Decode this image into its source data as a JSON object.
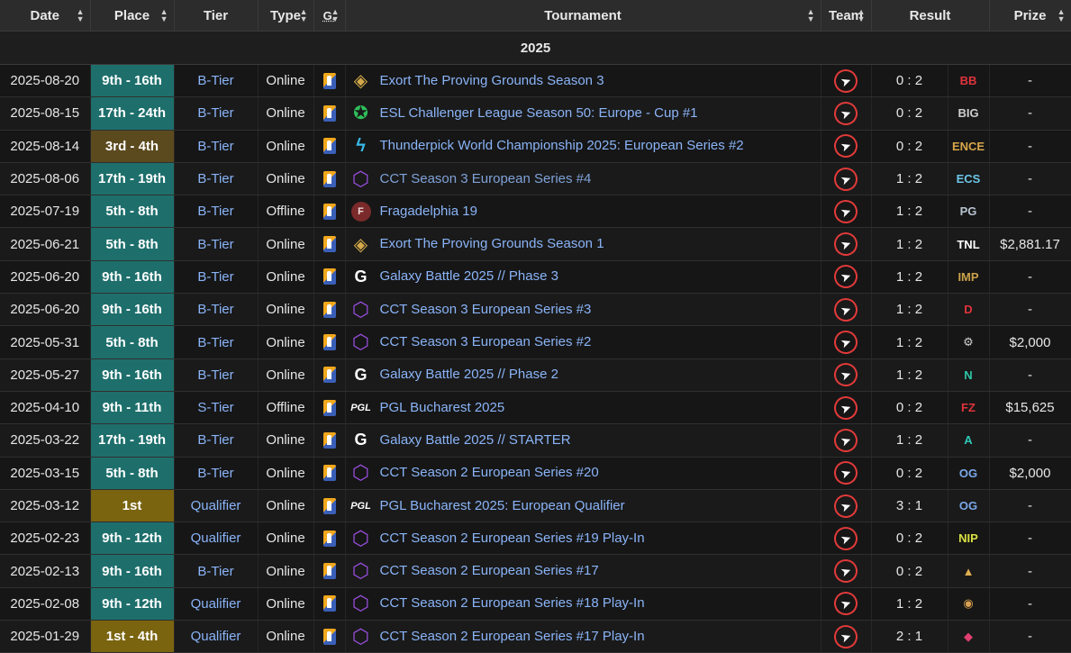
{
  "header": {
    "date": "Date",
    "place": "Place",
    "tier": "Tier",
    "type": "Type",
    "game": "G.",
    "tournament": "Tournament",
    "team": "Team",
    "result": "Result",
    "prize": "Prize"
  },
  "year": "2025",
  "rows": [
    {
      "date": "2025-08-20",
      "place": "9th - 16th",
      "placeStyle": "teal",
      "tier": "B-Tier",
      "type": "Online",
      "ticon": "exort",
      "tournament": "Exort The Proving Grounds Season 3",
      "score": "0 : 2",
      "opp": "BB",
      "oppColor": "#e0343c",
      "prize": "-"
    },
    {
      "date": "2025-08-15",
      "place": "17th - 24th",
      "placeStyle": "teal",
      "tier": "B-Tier",
      "type": "Online",
      "ticon": "esl",
      "tournament": "ESL Challenger League Season 50: Europe - Cup #1",
      "score": "0 : 2",
      "opp": "BIG",
      "oppColor": "#cfcfcf",
      "prize": "-"
    },
    {
      "date": "2025-08-14",
      "place": "3rd - 4th",
      "placeStyle": "brown",
      "tier": "B-Tier",
      "type": "Online",
      "ticon": "thunder",
      "tournament": "Thunderpick World Championship 2025: European Series #2",
      "score": "0 : 2",
      "opp": "ENCE",
      "oppColor": "#d8a64a",
      "prize": "-"
    },
    {
      "date": "2025-08-06",
      "place": "17th - 19th",
      "placeStyle": "teal",
      "tier": "B-Tier",
      "type": "Online",
      "ticon": "cct",
      "tournament": "CCT Season 3 European Series #4",
      "score": "1 : 2",
      "opp": "ECS",
      "oppColor": "#6cc6e8",
      "prize": "-",
      "dim": true
    },
    {
      "date": "2025-07-19",
      "place": "5th - 8th",
      "placeStyle": "teal",
      "tier": "B-Tier",
      "type": "Offline",
      "ticon": "frag",
      "tournament": "Fragadelphia 19",
      "score": "1 : 2",
      "opp": "PG",
      "oppColor": "#b8c4d0",
      "prize": "-"
    },
    {
      "date": "2025-06-21",
      "place": "5th - 8th",
      "placeStyle": "teal",
      "tier": "B-Tier",
      "type": "Online",
      "ticon": "exort",
      "tournament": "Exort The Proving Grounds Season 1",
      "score": "1 : 2",
      "opp": "TNL",
      "oppColor": "#ffffff",
      "prize": "$2,881.17"
    },
    {
      "date": "2025-06-20",
      "place": "9th - 16th",
      "placeStyle": "teal",
      "tier": "B-Tier",
      "type": "Online",
      "ticon": "galaxy",
      "tournament": "Galaxy Battle 2025 // Phase 3",
      "score": "1 : 2",
      "opp": "IMP",
      "oppColor": "#c9a24a",
      "prize": "-"
    },
    {
      "date": "2025-06-20",
      "place": "9th - 16th",
      "placeStyle": "teal",
      "tier": "B-Tier",
      "type": "Online",
      "ticon": "cct",
      "tournament": "CCT Season 3 European Series #3",
      "score": "1 : 2",
      "opp": "D",
      "oppColor": "#e0343c",
      "prize": "-"
    },
    {
      "date": "2025-05-31",
      "place": "5th - 8th",
      "placeStyle": "teal",
      "tier": "B-Tier",
      "type": "Online",
      "ticon": "cct",
      "tournament": "CCT Season 3 European Series #2",
      "score": "1 : 2",
      "opp": "⚙",
      "oppColor": "#cfcfcf",
      "prize": "$2,000"
    },
    {
      "date": "2025-05-27",
      "place": "9th - 16th",
      "placeStyle": "teal",
      "tier": "B-Tier",
      "type": "Online",
      "ticon": "galaxy",
      "tournament": "Galaxy Battle 2025 // Phase 2",
      "score": "1 : 2",
      "opp": "N",
      "oppColor": "#2fc8a8",
      "prize": "-"
    },
    {
      "date": "2025-04-10",
      "place": "9th - 11th",
      "placeStyle": "teal",
      "tier": "S-Tier",
      "type": "Offline",
      "ticon": "pgl",
      "tournament": "PGL Bucharest 2025",
      "score": "0 : 2",
      "opp": "FZ",
      "oppColor": "#e0343c",
      "prize": "$15,625"
    },
    {
      "date": "2025-03-22",
      "place": "17th - 19th",
      "placeStyle": "teal",
      "tier": "B-Tier",
      "type": "Online",
      "ticon": "galaxy",
      "tournament": "Galaxy Battle 2025 // STARTER",
      "score": "1 : 2",
      "opp": "A",
      "oppColor": "#2fc8b8",
      "prize": "-"
    },
    {
      "date": "2025-03-15",
      "place": "5th - 8th",
      "placeStyle": "teal",
      "tier": "B-Tier",
      "type": "Online",
      "ticon": "cct",
      "tournament": "CCT Season 2 European Series #20",
      "score": "0 : 2",
      "opp": "OG",
      "oppColor": "#7aa8e8",
      "prize": "$2,000"
    },
    {
      "date": "2025-03-12",
      "place": "1st",
      "placeStyle": "gold",
      "tier": "Qualifier",
      "type": "Online",
      "ticon": "pgl",
      "tournament": "PGL Bucharest 2025: European Qualifier",
      "score": "3 : 1",
      "opp": "OG",
      "oppColor": "#7aa8e8",
      "prize": "-"
    },
    {
      "date": "2025-02-23",
      "place": "9th - 12th",
      "placeStyle": "teal",
      "tier": "Qualifier",
      "type": "Online",
      "ticon": "cct",
      "tournament": "CCT Season 2 European Series #19 Play-In",
      "score": "0 : 2",
      "opp": "NIP",
      "oppColor": "#d8e040",
      "prize": "-"
    },
    {
      "date": "2025-02-13",
      "place": "9th - 16th",
      "placeStyle": "teal",
      "tier": "B-Tier",
      "type": "Online",
      "ticon": "cct",
      "tournament": "CCT Season 2 European Series #17",
      "score": "0 : 2",
      "opp": "▲",
      "oppColor": "#e0b050",
      "prize": "-"
    },
    {
      "date": "2025-02-08",
      "place": "9th - 12th",
      "placeStyle": "teal",
      "tier": "Qualifier",
      "type": "Online",
      "ticon": "cct",
      "tournament": "CCT Season 2 European Series #18 Play-In",
      "score": "1 : 2",
      "opp": "◉",
      "oppColor": "#d8a050",
      "prize": "-"
    },
    {
      "date": "2025-01-29",
      "place": "1st - 4th",
      "placeStyle": "gold",
      "tier": "Qualifier",
      "type": "Online",
      "ticon": "cct",
      "tournament": "CCT Season 2 European Series #17 Play-In",
      "score": "2 : 1",
      "opp": "◆",
      "oppColor": "#e04070",
      "prize": "-"
    }
  ]
}
